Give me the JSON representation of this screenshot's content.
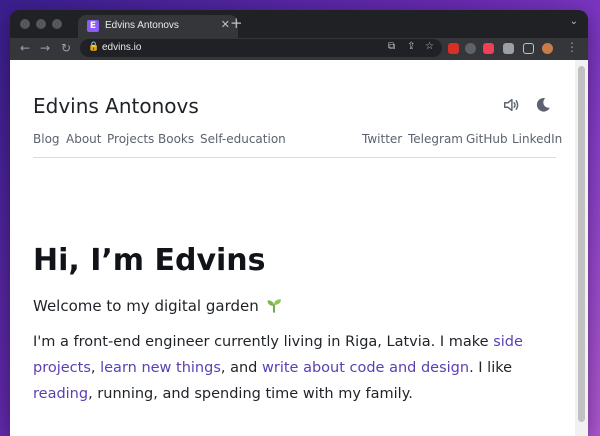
{
  "browser": {
    "tab_title": "Edvins Antonovs",
    "tab_favicon_letter": "E",
    "new_tab_label": "+",
    "url": "edvins.io"
  },
  "site": {
    "title": "Edvins Antonovs",
    "nav_left": [
      "Blog",
      "About",
      "Projects",
      "Books",
      "Self-education"
    ],
    "nav_right": [
      "Twitter",
      "Telegram",
      "GitHub",
      "LinkedIn"
    ],
    "icons": [
      "speaker-icon",
      "moon-icon"
    ]
  },
  "hero": {
    "heading": "Hi, I’m Edvins",
    "welcome": "Welcome to my digital garden",
    "para": {
      "t1": "I'm a front-end engineer currently living in Riga, Latvia. I make ",
      "l1": "side projects",
      "t2": ", ",
      "l2": "learn new things",
      "t3": ", and ",
      "l3": "write about code and design",
      "t4": ". I like ",
      "l4": "reading",
      "t5": ", running, and spending time with my family."
    }
  },
  "colors": {
    "link": "#5b3fb3",
    "accent": "#8b5cf6",
    "nav_text": "#5c6270",
    "browser_dark": "#202124"
  }
}
